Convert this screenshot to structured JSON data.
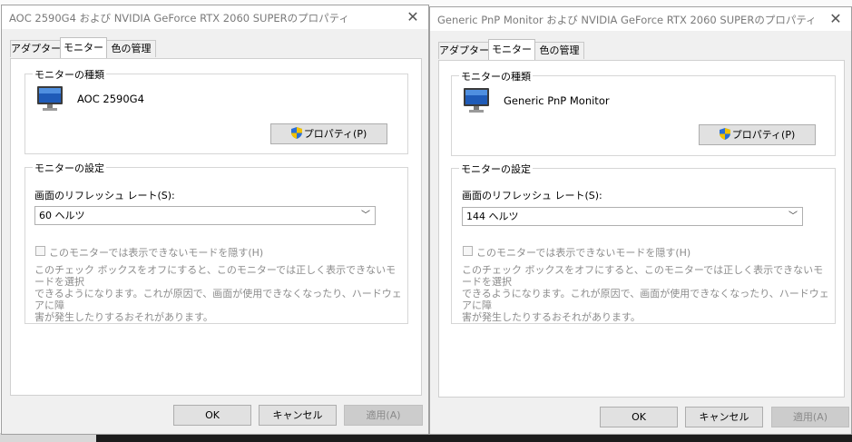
{
  "left": {
    "title": "AOC 2590G4 および NVIDIA GeForce RTX 2060 SUPERのプロパティ",
    "tabs": [
      "アダプター",
      "モニター",
      "色の管理"
    ],
    "monitor_type_group": "モニターの種類",
    "monitor_name": "AOC 2590G4",
    "properties_button": "プロパティ(P)",
    "monitor_settings_group": "モニターの設定",
    "refresh_label": "画面のリフレッシュ レート(S):",
    "refresh_value": "60 ヘルツ",
    "hide_modes_label": "このモニターでは表示できないモードを隠す(H)",
    "desc_line1": "このチェック ボックスをオフにすると、このモニターでは正しく表示できないモードを選択",
    "desc_line2": "できるようになります。これが原因で、画面が使用できなくなったり、ハードウェアに障",
    "desc_line3": "害が発生したりするおそれがあります。",
    "ok_button": "OK",
    "cancel_button": "キャンセル",
    "apply_button": "適用(A)"
  },
  "right": {
    "title": "Generic PnP Monitor および NVIDIA GeForce RTX 2060 SUPERのプロパティ",
    "tabs": [
      "アダプター",
      "モニター",
      "色の管理"
    ],
    "monitor_type_group": "モニターの種類",
    "monitor_name": "Generic PnP Monitor",
    "properties_button": "プロパティ(P)",
    "monitor_settings_group": "モニターの設定",
    "refresh_label": "画面のリフレッシュ レート(S):",
    "refresh_value": "144 ヘルツ",
    "hide_modes_label": "このモニターでは表示できないモードを隠す(H)",
    "desc_line1": "このチェック ボックスをオフにすると、このモニターでは正しく表示できないモードを選択",
    "desc_line2": "できるようになります。これが原因で、画面が使用できなくなったり、ハードウェアに障",
    "desc_line3": "害が発生したりするおそれがあります。",
    "ok_button": "OK",
    "cancel_button": "キャンセル",
    "apply_button": "適用(A)"
  },
  "icons": {
    "close": "close-icon",
    "monitor": "monitor-icon",
    "shield": "uac-shield-icon",
    "dropdown": "chevron-down-icon"
  },
  "colors": {
    "dialog_bg": "#f0f0f0",
    "panel_bg": "#ffffff",
    "button_bg": "#e1e1e1",
    "disabled_text": "#8c8c8c",
    "shield_blue": "#2a6fd6",
    "shield_yellow": "#f2c200"
  }
}
